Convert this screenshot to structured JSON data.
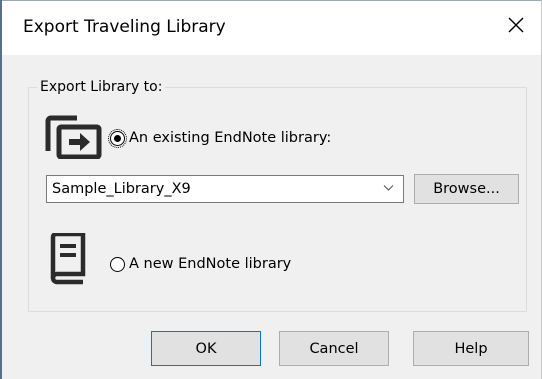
{
  "window": {
    "title": "Export Traveling Library",
    "close_icon": "close-icon"
  },
  "group": {
    "label": "Export Library to:"
  },
  "options": {
    "existing": {
      "label": "An existing EndNote library:",
      "selected": true,
      "icon": "export-to-library-icon"
    },
    "new": {
      "label": "A new EndNote library",
      "selected": false,
      "icon": "book-icon"
    }
  },
  "library_select": {
    "value": "Sample_Library_X9",
    "icon": "chevron-down-icon"
  },
  "buttons": {
    "browse": "Browse...",
    "ok": "OK",
    "cancel": "Cancel",
    "help": "Help"
  },
  "colors": {
    "accent": "#0078d7",
    "dialog_background": "#f0f0f0",
    "button_face": "#e1e1e1"
  }
}
